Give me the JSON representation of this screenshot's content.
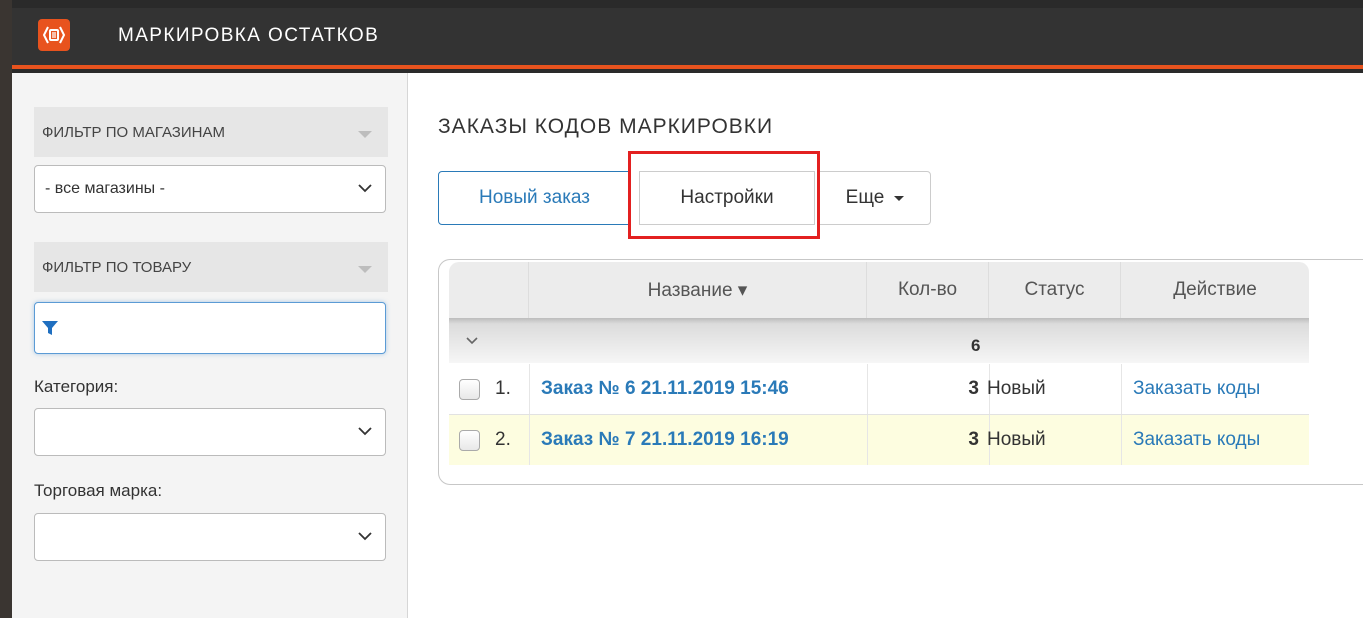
{
  "app": {
    "title": "МАРКИРОВКА ОСТАТКОВ",
    "accent_color": "#e8531e",
    "logo_icon": "marking-box-icon"
  },
  "sidebar": {
    "shop_filter": {
      "heading": "ФИЛЬТР ПО МАГАЗИНАМ",
      "selected": "- все магазины -"
    },
    "product_filter": {
      "heading": "ФИЛЬТР ПО ТОВАРУ",
      "input_value": "",
      "input_icon": "funnel-icon"
    },
    "category": {
      "label": "Категория:",
      "selected": ""
    },
    "brand": {
      "label": "Торговая марка:",
      "selected": ""
    }
  },
  "main": {
    "title": "ЗАКАЗЫ КОДОВ МАРКИРОВКИ",
    "toolbar": {
      "new_order": "Новый заказ",
      "settings": "Настройки",
      "more": "Еще"
    },
    "table": {
      "columns": [
        "Название ▾",
        "Кол-во",
        "Статус",
        "Действие"
      ],
      "group": {
        "total_qty": "6"
      },
      "rows": [
        {
          "num": "1.",
          "name": "Заказ № 6 21.11.2019 15:46",
          "qty": "3",
          "status": "Новый",
          "action": "Заказать коды"
        },
        {
          "num": "2.",
          "name": "Заказ № 7 21.11.2019 16:19",
          "qty": "3",
          "status": "Новый",
          "action": "Заказать коды"
        }
      ]
    }
  }
}
